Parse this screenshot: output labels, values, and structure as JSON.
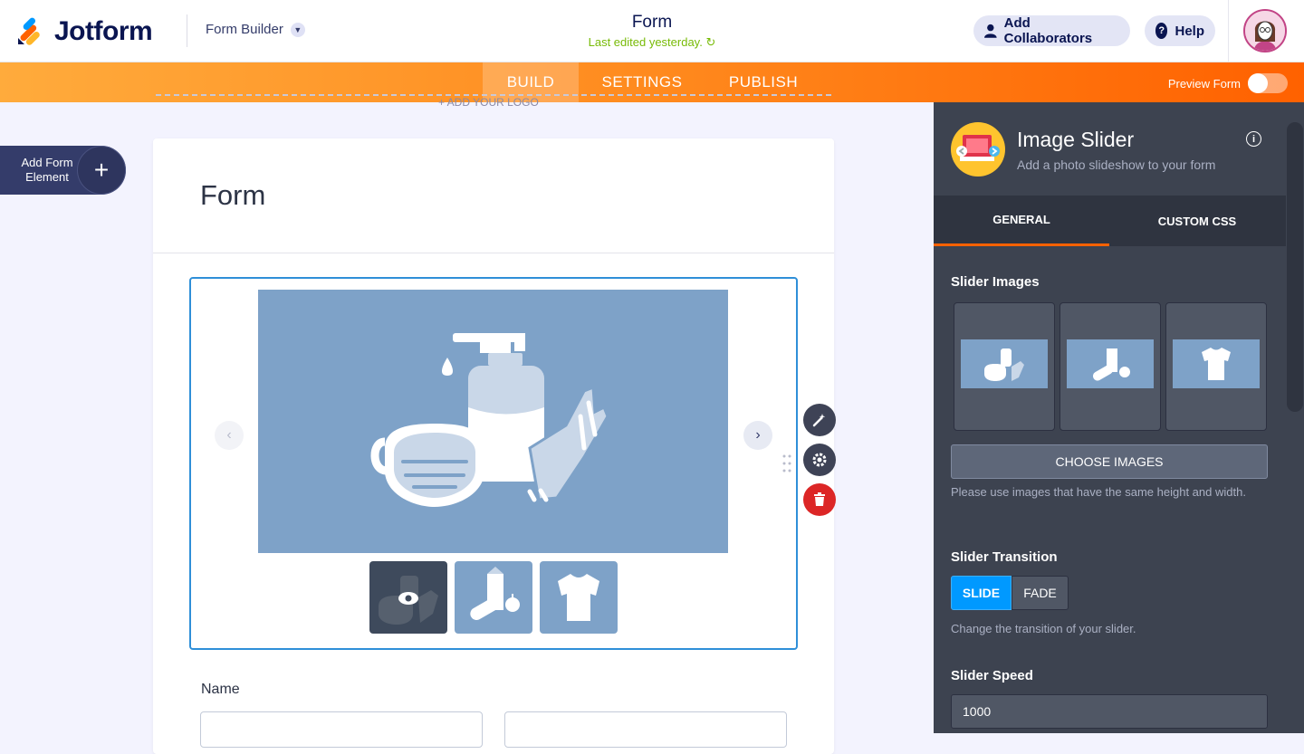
{
  "header": {
    "brand": "Jotform",
    "builder_menu": "Form Builder",
    "form_title": "Form",
    "last_edited": "Last edited yesterday.",
    "add_collaborators": "Add Collaborators",
    "help": "Help"
  },
  "nav": {
    "tabs": [
      {
        "label": "BUILD",
        "active": true
      },
      {
        "label": "SETTINGS",
        "active": false
      },
      {
        "label": "PUBLISH",
        "active": false
      }
    ],
    "preview_label": "Preview Form",
    "preview_on": false
  },
  "canvas": {
    "add_logo": "+ ADD YOUR LOGO",
    "add_element_label": "Add Form Element",
    "form_heading": "Form",
    "name_label": "Name",
    "slider": {
      "thumbnails": [
        "hygiene-icon",
        "food-icon",
        "tshirt-icon"
      ],
      "selected_index": 0
    }
  },
  "panel": {
    "title": "Image Slider",
    "subtitle": "Add a photo slideshow to your form",
    "tabs": [
      {
        "label": "GENERAL",
        "active": true
      },
      {
        "label": "CUSTOM CSS",
        "active": false
      }
    ],
    "slider_images_label": "Slider Images",
    "choose_images": "CHOOSE IMAGES",
    "images_hint": "Please use images that have the same height and width.",
    "transition_label": "Slider Transition",
    "transition_options": [
      "SLIDE",
      "FADE"
    ],
    "transition_selected": "SLIDE",
    "transition_hint": "Change the transition of your slider.",
    "speed_label": "Slider Speed",
    "speed_value": "1000"
  },
  "colors": {
    "brand_navy": "#0a1551",
    "orange": "#ff6100",
    "accent_blue": "#0099ff",
    "image_blue": "#7ea2c8",
    "delete_red": "#dc2626"
  }
}
